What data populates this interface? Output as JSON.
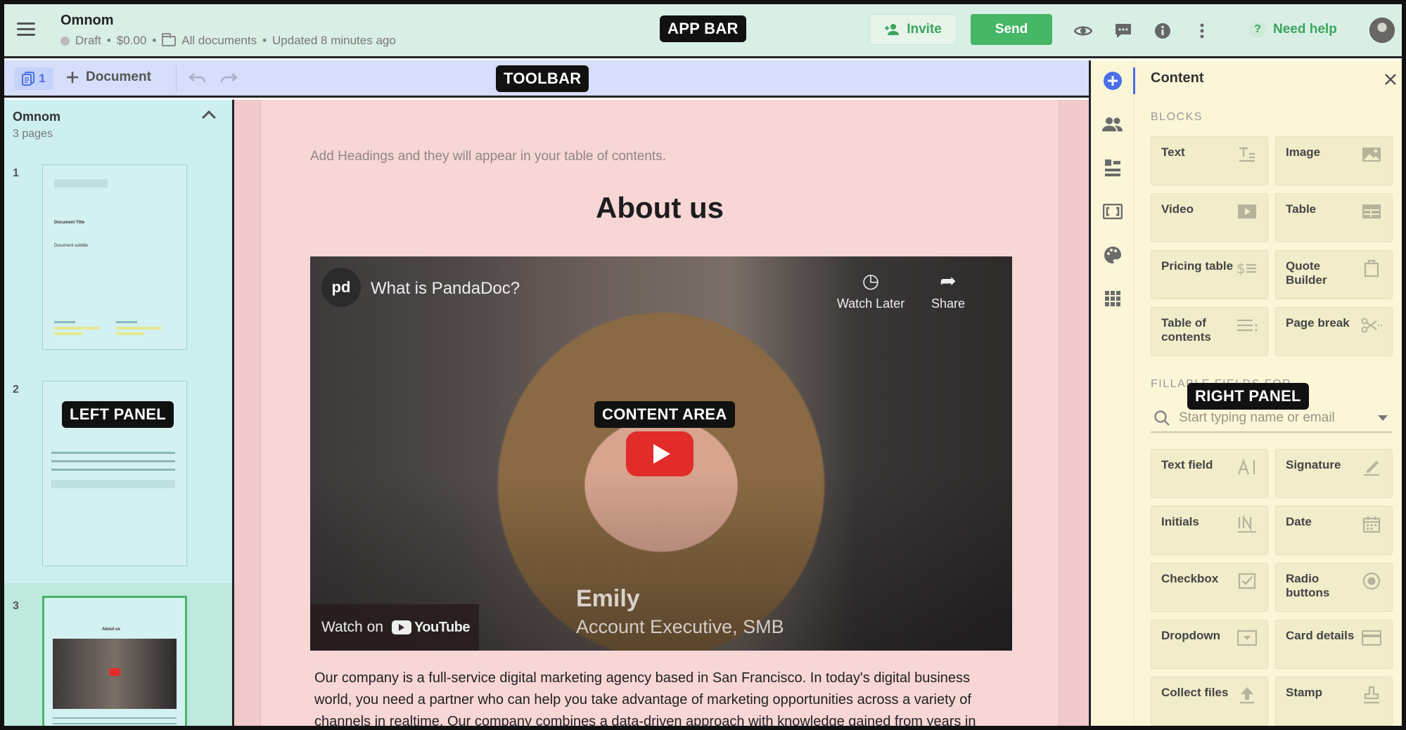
{
  "app_bar": {
    "doc_title": "Omnom",
    "status": "Draft",
    "price": "$0.00",
    "folder": "All documents",
    "updated": "Updated 8 minutes ago",
    "annotation": "APP BAR",
    "invite_label": "Invite",
    "send_label": "Send",
    "help_label": "Need help",
    "icons": [
      "menu-icon",
      "eye-icon",
      "comment-icon",
      "info-icon",
      "more-vertical-icon",
      "help-icon",
      "avatar"
    ]
  },
  "toolbar": {
    "page_count": "1",
    "add_document_label": "Document",
    "annotation": "TOOLBAR"
  },
  "left_panel": {
    "title": "Omnom",
    "subtitle": "3 pages",
    "annotation": "LEFT PANEL",
    "pages": [
      {
        "number": "1",
        "title": "Document Title",
        "subtitle": "Document subtitle"
      },
      {
        "number": "2"
      },
      {
        "number": "3",
        "title": "About us"
      }
    ]
  },
  "content": {
    "annotation": "CONTENT AREA",
    "toc_hint": "Add Headings and they will appear in your table of contents.",
    "heading": "About us",
    "video": {
      "title": "What is PandaDoc?",
      "watch_later": "Watch Later",
      "share": "Share",
      "watch_on": "Watch on",
      "youtube": "YouTube",
      "person_name": "Emily",
      "person_role": "Account Executive, SMB"
    },
    "body": "Our company is a full-service digital marketing agency based in San Francisco. In today's digital business world, you need a partner who can help you take advantage of marketing opportunities across a variety of channels in realtime. Our company combines a data-driven approach with knowledge gained from years in"
  },
  "right_panel": {
    "title": "Content",
    "annotation": "RIGHT PANEL",
    "blocks_heading": "BLOCKS",
    "blocks": [
      {
        "label": "Text",
        "icon": "text-icon"
      },
      {
        "label": "Image",
        "icon": "image-icon"
      },
      {
        "label": "Video",
        "icon": "video-icon"
      },
      {
        "label": "Table",
        "icon": "table-icon"
      },
      {
        "label": "Pricing table",
        "icon": "pricing-table-icon"
      },
      {
        "label": "Quote Builder",
        "icon": "quote-builder-icon"
      },
      {
        "label": "Table of contents",
        "icon": "toc-icon"
      },
      {
        "label": "Page break",
        "icon": "scissors-icon"
      }
    ],
    "fields_heading": "FILLABLE FIELDS FOR",
    "search_placeholder": "Start typing name or email",
    "fields": [
      {
        "label": "Text field",
        "icon": "text-field-icon"
      },
      {
        "label": "Signature",
        "icon": "signature-icon"
      },
      {
        "label": "Initials",
        "icon": "initials-icon"
      },
      {
        "label": "Date",
        "icon": "calendar-icon"
      },
      {
        "label": "Checkbox",
        "icon": "checkbox-icon"
      },
      {
        "label": "Radio buttons",
        "icon": "radio-icon"
      },
      {
        "label": "Dropdown",
        "icon": "dropdown-icon"
      },
      {
        "label": "Card details",
        "icon": "card-icon"
      },
      {
        "label": "Collect files",
        "icon": "upload-icon"
      },
      {
        "label": "Stamp",
        "icon": "stamp-icon"
      }
    ]
  },
  "colors": {
    "app_bar_bg": "#d9efe5",
    "toolbar_bg": "#d6defb",
    "left_panel_bg": "#cdeff0",
    "content_bg": "#f8d6d6",
    "right_panel_bg": "#fbf6d8",
    "accent_green": "#45b766",
    "accent_blue": "#4a6fe8"
  }
}
